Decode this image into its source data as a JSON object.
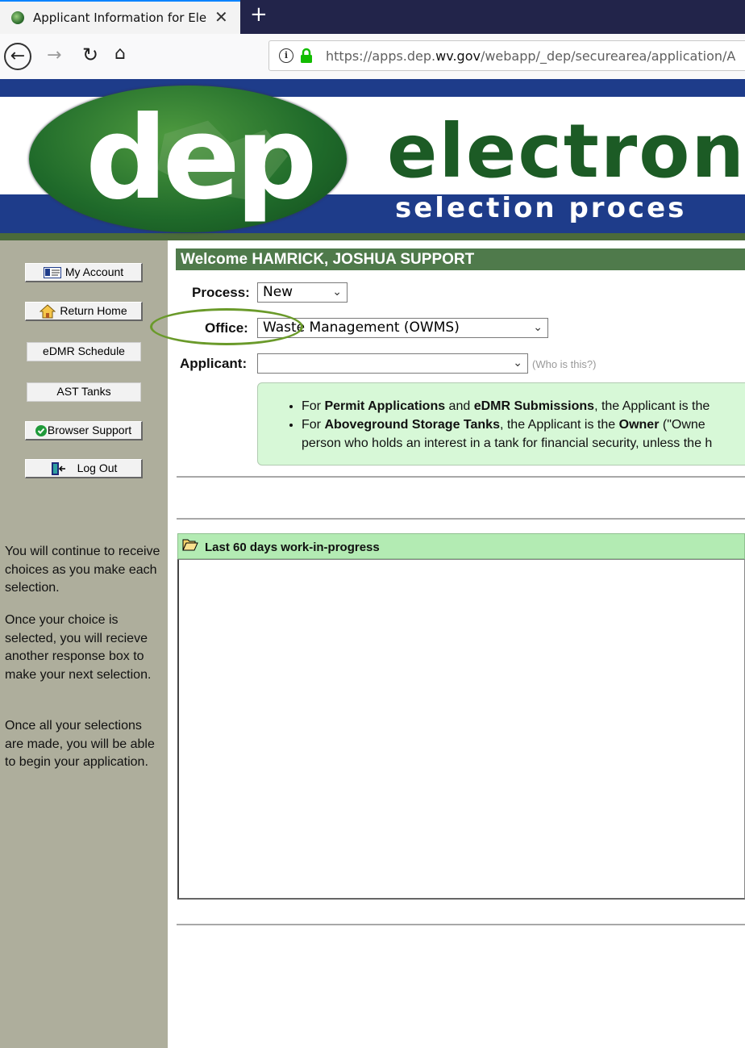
{
  "browser": {
    "tab_title": "Applicant Information for Electronic Submission",
    "close_glyph": "✕",
    "new_tab_glyph": "+",
    "url_prefix": "https://apps.dep.",
    "url_domain": "wv.gov",
    "url_suffix": "/webapp/_dep/securearea/application/A"
  },
  "banner": {
    "logo_text": "dep",
    "title": "electroni",
    "subtitle": "selection proces"
  },
  "sidebar": {
    "buttons": [
      {
        "label": "My Account",
        "icon": "id-card-icon"
      },
      {
        "label": "Return Home",
        "icon": "home-icon"
      },
      {
        "label": "eDMR Schedule"
      },
      {
        "label": "AST Tanks"
      },
      {
        "label": "Browser Support",
        "icon": "check-icon"
      },
      {
        "label": "Log Out",
        "icon": "door-icon"
      }
    ],
    "help": [
      "You will continue to receive choices as you make each selection.",
      "Once your choice is selected, you will recieve another response box to make your next selection.",
      "Once all your selections are made, you will be able to begin your application."
    ]
  },
  "main": {
    "welcome": "Welcome HAMRICK, JOSHUA SUPPORT",
    "process_label": "Process:",
    "process_value": "New",
    "office_label": "Office:",
    "office_value": "Waste Management (OWMS)",
    "applicant_label": "Applicant:",
    "applicant_value": "",
    "who_link": "(Who is this?)",
    "note": {
      "b1_pre": "For ",
      "b1_bold1": "Permit Applications",
      "b1_mid": " and ",
      "b1_bold2": "eDMR Submissions",
      "b1_post": ", the Applicant is the",
      "b2_pre": "For ",
      "b2_bold1": "Aboveground Storage Tanks",
      "b2_mid": ", the Applicant is the ",
      "b2_bold2": "Owner",
      "b2_post": " (\"Owne",
      "b2_line2": "person who holds an interest in a tank for financial security, unless the h"
    },
    "wip_title": "Last 60 days work-in-progress"
  },
  "colors": {
    "sidebar_bg": "#aeae9c",
    "welcome_bar": "#4f7a4b",
    "note_bg": "#d7f8d7",
    "wip_header": "#b3ebb3",
    "banner_blue": "#1e3c8a",
    "highlight_oval": "#6a9a2a"
  }
}
